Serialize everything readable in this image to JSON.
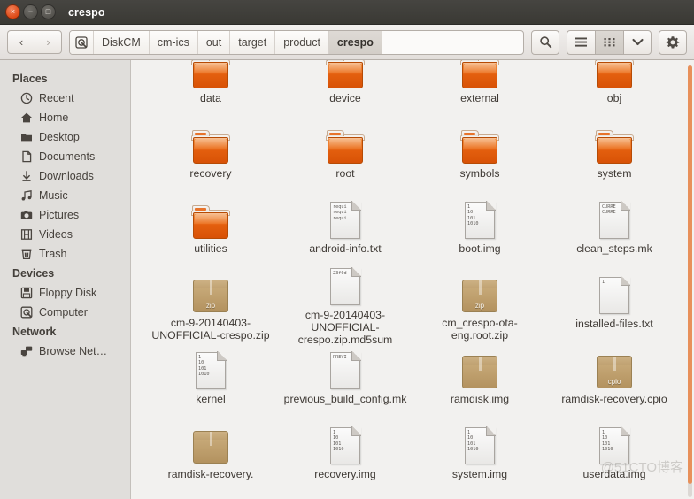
{
  "window": {
    "title": "crespo",
    "controls": [
      {
        "name": "close",
        "glyph": "×"
      },
      {
        "name": "minimize",
        "glyph": "−"
      },
      {
        "name": "maximize",
        "glyph": "□"
      }
    ]
  },
  "toolbar": {
    "back_glyph": "‹",
    "forward_glyph": "›",
    "breadcrumbs": [
      {
        "label": "DiskCM",
        "active": false
      },
      {
        "label": "cm-ics",
        "active": false
      },
      {
        "label": "out",
        "active": false
      },
      {
        "label": "target",
        "active": false
      },
      {
        "label": "product",
        "active": false
      },
      {
        "label": "crespo",
        "active": true
      }
    ],
    "search_label": "search-icon",
    "list_view_label": "list-view-icon",
    "icon_view_label": "icon-view-icon",
    "dropdown_label": "chevron-down-icon",
    "gear_label": "gear-icon"
  },
  "sidebar": {
    "sections": [
      {
        "title": "Places",
        "items": [
          {
            "label": "Recent",
            "icon": "clock-icon"
          },
          {
            "label": "Home",
            "icon": "home-icon"
          },
          {
            "label": "Desktop",
            "icon": "desktop-folder-icon"
          },
          {
            "label": "Documents",
            "icon": "document-icon"
          },
          {
            "label": "Downloads",
            "icon": "download-icon"
          },
          {
            "label": "Music",
            "icon": "music-icon"
          },
          {
            "label": "Pictures",
            "icon": "camera-icon"
          },
          {
            "label": "Videos",
            "icon": "film-icon"
          },
          {
            "label": "Trash",
            "icon": "trash-icon"
          }
        ]
      },
      {
        "title": "Devices",
        "items": [
          {
            "label": "Floppy Disk",
            "icon": "floppy-disk-icon"
          },
          {
            "label": "Computer",
            "icon": "computer-icon"
          }
        ]
      },
      {
        "title": "Network",
        "items": [
          {
            "label": "Browse Net…",
            "icon": "network-icon"
          }
        ]
      }
    ]
  },
  "files": [
    {
      "name": "data",
      "type": "folder",
      "preview": ""
    },
    {
      "name": "device",
      "type": "folder",
      "preview": ""
    },
    {
      "name": "external",
      "type": "folder",
      "preview": ""
    },
    {
      "name": "obj",
      "type": "folder",
      "preview": ""
    },
    {
      "name": "recovery",
      "type": "folder",
      "preview": ""
    },
    {
      "name": "root",
      "type": "folder",
      "preview": ""
    },
    {
      "name": "symbols",
      "type": "folder",
      "preview": ""
    },
    {
      "name": "system",
      "type": "folder",
      "preview": ""
    },
    {
      "name": "utilities",
      "type": "folder",
      "preview": ""
    },
    {
      "name": "android-info.txt",
      "type": "document",
      "preview": "requi\nrequi\nrequi"
    },
    {
      "name": "boot.img",
      "type": "document",
      "preview": "1\n10\n101\n1010"
    },
    {
      "name": "clean_steps.mk",
      "type": "document",
      "preview": "CURRE\nCURRE"
    },
    {
      "name": "cm-9-20140403-UNOFFICIAL-crespo.zip",
      "type": "archive",
      "preview": "zip"
    },
    {
      "name": "cm-9-20140403-UNOFFICIAL-crespo.zip.md5sum",
      "type": "document",
      "preview": "23f0d"
    },
    {
      "name": "cm_crespo-ota-eng.root.zip",
      "type": "archive",
      "preview": "zip"
    },
    {
      "name": "installed-files.txt",
      "type": "document",
      "preview": "1"
    },
    {
      "name": "kernel",
      "type": "document",
      "preview": "1\n10\n101\n1010"
    },
    {
      "name": "previous_build_config.mk",
      "type": "document",
      "preview": "PREVI"
    },
    {
      "name": "ramdisk.img",
      "type": "archive",
      "preview": ""
    },
    {
      "name": "ramdisk-recovery.cpio",
      "type": "archive",
      "preview": "cpio"
    },
    {
      "name": "ramdisk-recovery.",
      "type": "archive",
      "preview": ""
    },
    {
      "name": "recovery.img",
      "type": "document",
      "preview": "1\n10\n101\n1010"
    },
    {
      "name": "system.img",
      "type": "document",
      "preview": "1\n10\n101\n1010"
    },
    {
      "name": "userdata.img",
      "type": "document",
      "preview": "1\n10\n101\n1010"
    }
  ],
  "watermark": "@51CTO博客",
  "colors": {
    "titlebar": "#3c3b37",
    "accent_orange": "#dd4814",
    "folder_orange": "#e4600f",
    "archive_tan": "#c0a272",
    "sidebar_bg": "#e0dedb",
    "content_bg": "#f2f1ef"
  }
}
